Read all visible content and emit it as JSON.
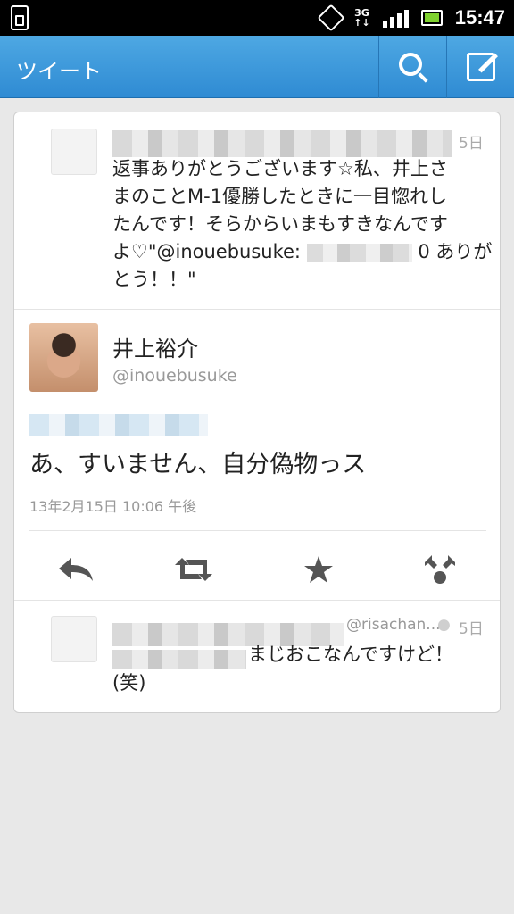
{
  "status_bar": {
    "network": "3G",
    "time": "15:47"
  },
  "action_bar": {
    "title": "ツイート",
    "search_icon": "search-icon",
    "compose_icon": "compose-icon"
  },
  "reply_tweet": {
    "time": "5日",
    "lines": [
      "返事ありがとうございます☆私、井上さ",
      "まのことM-1優勝したときに一目惚れし",
      "たんです！そらからいまもすきなんです",
      "よ♡\"@inouebusuke:",
      "0 ありが",
      "とう！！\""
    ]
  },
  "main_tweet": {
    "name": "井上裕介",
    "handle": "@inouebusuke",
    "text": "あ、すいません、自分偽物っス",
    "timestamp": "13年2月15日 10:06 午後",
    "actions": {
      "reply": "reply-icon",
      "retweet": "retweet-icon",
      "favorite": "star-icon",
      "more": "share-icon"
    }
  },
  "next_tweet": {
    "handle_fragment": "@risachan...",
    "time": "5日",
    "text_line1": "まじおこなんですけど！",
    "text_line2": "(笑)"
  }
}
